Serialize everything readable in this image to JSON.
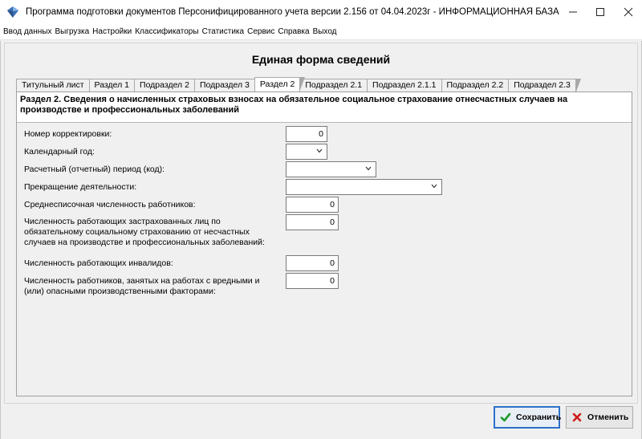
{
  "window": {
    "title": "Программа подготовки документов Персонифицированного учета версии 2.156 от 04.04.2023г - ИНФОРМАЦИОННАЯ БАЗА",
    "minimize": "—",
    "maximize": "☐",
    "close": "✕"
  },
  "menu": [
    "Ввод данных",
    "Выгрузка",
    "Настройки",
    "Классификаторы",
    "Статистика",
    "Сервис",
    "Справка",
    "Выход"
  ],
  "form": {
    "title": "Единая форма сведений",
    "tabs": [
      "Титульный лист",
      "Раздел 1",
      "Подраздел 2",
      "Подраздел 3",
      "Раздел 2",
      "Подраздел 2.1",
      "Подраздел 2.1.1",
      "Подраздел 2.2",
      "Подраздел 2.3"
    ],
    "active_tab": "Раздел 2",
    "section_heading": "Раздел 2. Сведения о начисленных страховых взносах на обязательное социальное страхование отнесчастных случаев на производстве и профессиональных заболеваний",
    "fields": {
      "correction_number": {
        "label": "Номер корректировки:",
        "value": "0"
      },
      "calendar_year": {
        "label": "Календарный год:",
        "value": ""
      },
      "period_code": {
        "label": "Расчетный (отчетный) период (код):",
        "value": ""
      },
      "termination": {
        "label": "Прекращение деятельности:",
        "value": ""
      },
      "avg_headcount": {
        "label": "Среднесписочная численность работников:",
        "value": "0"
      },
      "insured_count": {
        "label": "Численность работающих застрахованных лиц по обязательному социальному страхованию от несчастных случаев на производстве и профессиональных заболеваний:",
        "value": "0"
      },
      "disabled_count": {
        "label": "Численность работающих инвалидов:",
        "value": "0"
      },
      "hazardous_count": {
        "label": "Численность работников, занятых на работах с вредными и (или) опасными производственными факторами:",
        "value": "0"
      }
    }
  },
  "buttons": {
    "save": "Сохранить",
    "cancel": "Отменить"
  },
  "colors": {
    "save_check": "#1e9a2a",
    "cancel_x": "#d01c1c",
    "primary_border": "#2d71c8"
  }
}
